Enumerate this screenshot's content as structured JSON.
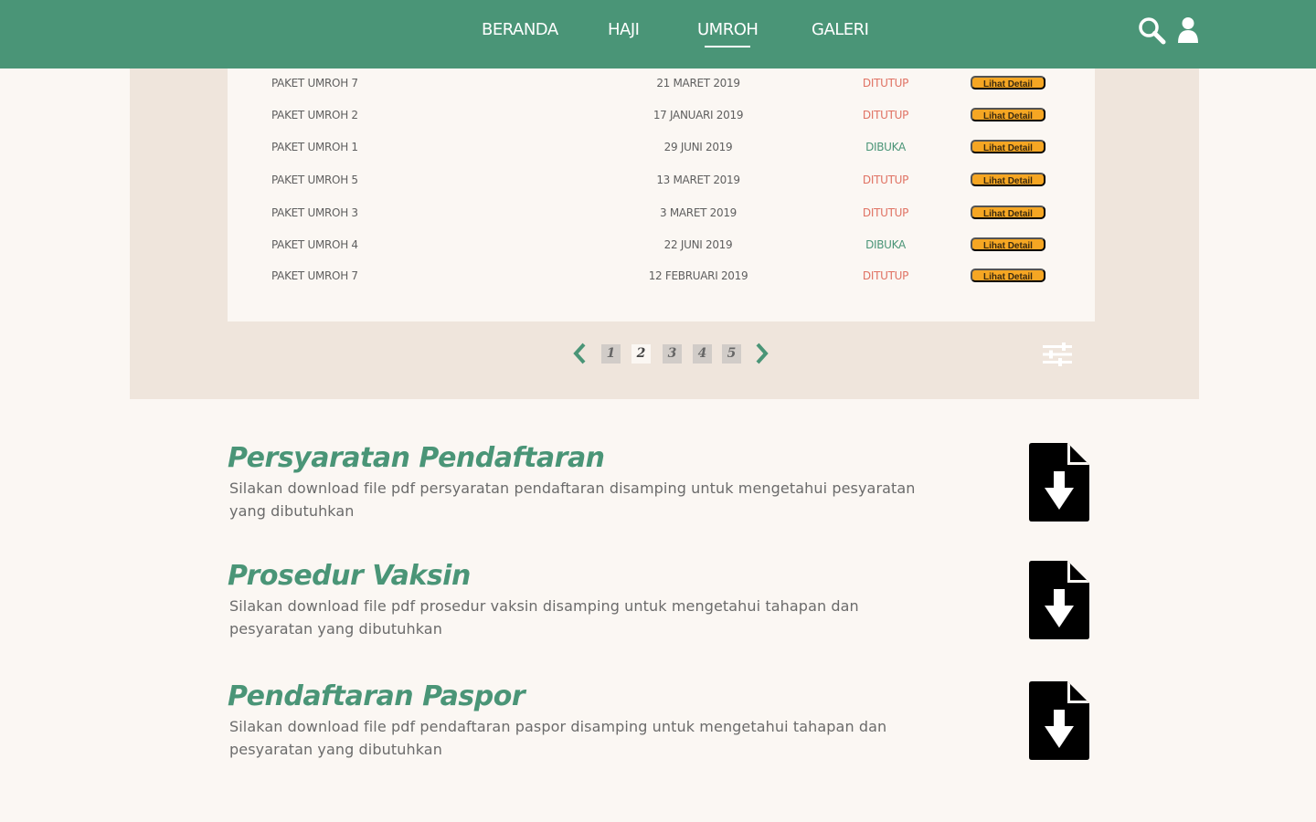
{
  "nav": {
    "items": [
      {
        "label": "BERANDA",
        "active": false
      },
      {
        "label": "HAJI",
        "active": false
      },
      {
        "label": "UMROH",
        "active": true
      },
      {
        "label": "GALERI",
        "active": false
      }
    ],
    "icons": [
      "search-icon",
      "user-icon"
    ]
  },
  "table": {
    "rows": [
      {
        "name": "PAKET UMROH 7",
        "date": "21 MARET 2019",
        "status": "DITUTUP",
        "action": "Lihat Detail"
      },
      {
        "name": "PAKET UMROH 2",
        "date": "17 JANUARI 2019",
        "status": "DITUTUP",
        "action": "Lihat Detail"
      },
      {
        "name": "PAKET UMROH 1",
        "date": "29 JUNI 2019",
        "status": "DIBUKA",
        "action": "Lihat Detail"
      },
      {
        "name": "PAKET UMROH 5",
        "date": "13 MARET 2019",
        "status": "DITUTUP",
        "action": "Lihat Detail"
      },
      {
        "name": "PAKET UMROH 3",
        "date": "3 MARET 2019",
        "status": "DITUTUP",
        "action": "Lihat Detail"
      },
      {
        "name": "PAKET UMROH 4",
        "date": "22 JUNI 2019",
        "status": "DIBUKA",
        "action": "Lihat Detail"
      },
      {
        "name": "PAKET UMROH 7",
        "date": "12 FEBRUARI 2019",
        "status": "DITUTUP",
        "action": "Lihat Detail"
      }
    ]
  },
  "pagination": {
    "pages": [
      "1",
      "2",
      "3",
      "4",
      "5"
    ],
    "current_page": "2"
  },
  "downloads": [
    {
      "title": "Persyaratan Pendaftaran",
      "description": "Silakan download file pdf persyaratan pendaftaran disamping untuk mengetahui pesyaratan yang dibutuhkan",
      "icon": "file-download-icon"
    },
    {
      "title": "Prosedur Vaksin",
      "description": "Silakan download file pdf prosedur vaksin disamping untuk mengetahui tahapan dan pesyaratan yang dibutuhkan",
      "icon": "file-download-icon"
    },
    {
      "title": "Pendaftaran Paspor",
      "description": "Silakan download file pdf pendaftaran paspor disamping untuk mengetahui tahapan dan pesyaratan yang dibutuhkan",
      "icon": "file-download-icon"
    }
  ],
  "colors": {
    "brand_green": "#4a9577",
    "status_closed": "#e07263",
    "status_open": "#4a9577",
    "button_orange": "#f5a623",
    "panel_bg": "#efe5dc",
    "page_bg": "#fbf7f3"
  }
}
